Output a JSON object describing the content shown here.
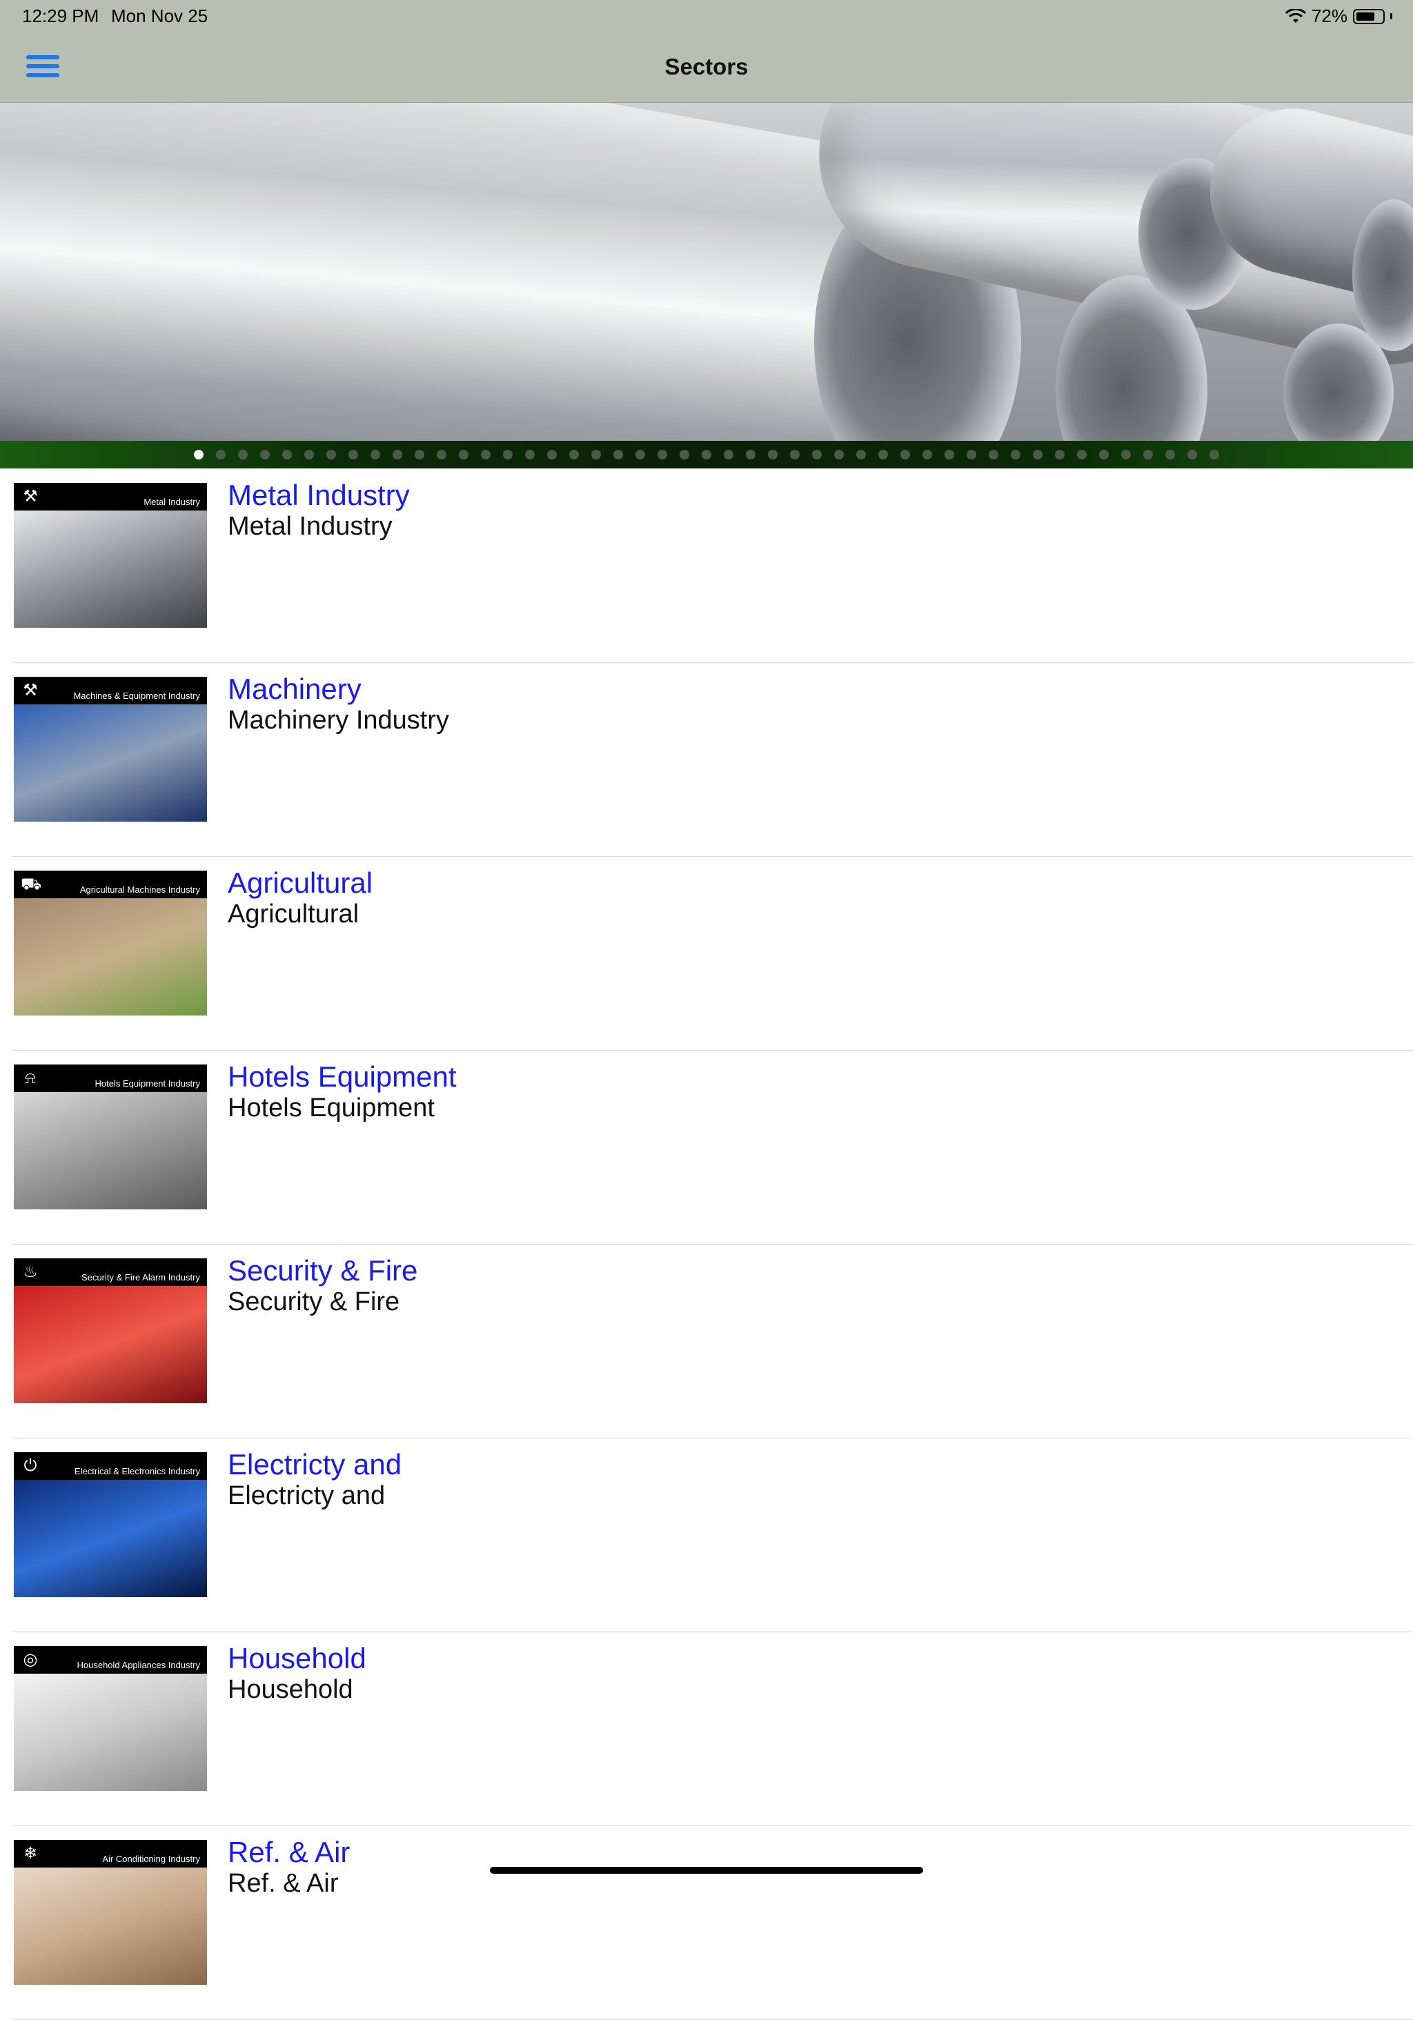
{
  "status_bar": {
    "time": "12:29 PM",
    "date": "Mon Nov 25",
    "battery": "72%",
    "battery_level": 0.72
  },
  "nav": {
    "title": "Sectors",
    "menu_icon": "hamburger-menu-icon",
    "accent": "#1778f2"
  },
  "carousel": {
    "page_count": 47,
    "active_index": 0
  },
  "sectors": [
    {
      "title": "Metal Industry",
      "subtitle": "Metal Industry",
      "thumb_caption": "Metal Industry",
      "thumb_icon": "tools-icon",
      "thumb_colors": [
        "#e6e8ea",
        "#8f9398",
        "#3e4246"
      ]
    },
    {
      "title": "Machinery",
      "subtitle": "Machinery Industry",
      "thumb_caption": "Machines & Equipment Industry",
      "thumb_icon": "drill-icon",
      "thumb_colors": [
        "#2f5fb8",
        "#8ea0b8",
        "#1b2f66"
      ]
    },
    {
      "title": "Agricultural",
      "subtitle": "Agricultural",
      "thumb_caption": "Agricultural Machines Industry",
      "thumb_icon": "tractor-icon",
      "thumb_colors": [
        "#a58a6e",
        "#c7b08c",
        "#6f9b3e"
      ]
    },
    {
      "title": "Hotels Equipment",
      "subtitle": "Hotels Equipment",
      "thumb_caption": "Hotels Equipment Industry",
      "thumb_icon": "service-bell-icon",
      "thumb_colors": [
        "#d8d8d8",
        "#9a9a9a",
        "#5a5a5a"
      ]
    },
    {
      "title": "Security & Fire",
      "subtitle": "Security & Fire",
      "thumb_caption": "Security & Fire Alarm Industry",
      "thumb_icon": "flame-icon",
      "thumb_colors": [
        "#c81f1f",
        "#ef5a4a",
        "#7a0e0e"
      ]
    },
    {
      "title": "Electricty and",
      "subtitle": "Electricty and",
      "thumb_caption": "Electrical & Electronics Industry",
      "thumb_icon": "plug-icon",
      "thumb_colors": [
        "#0e2d7a",
        "#2f6fd8",
        "#061540"
      ]
    },
    {
      "title": "Household",
      "subtitle": "Household",
      "thumb_caption": "Household Appliances Industry",
      "thumb_icon": "washing-machine-icon",
      "thumb_colors": [
        "#f4f4f4",
        "#c8c8c8",
        "#8a8a8a"
      ]
    },
    {
      "title": "Ref. & Air",
      "subtitle": "Ref. & Air",
      "thumb_caption": "Air Conditioning Industry",
      "thumb_icon": "air-conditioner-icon",
      "thumb_colors": [
        "#e8d8c8",
        "#c9a98a",
        "#8a6a4a"
      ]
    }
  ]
}
